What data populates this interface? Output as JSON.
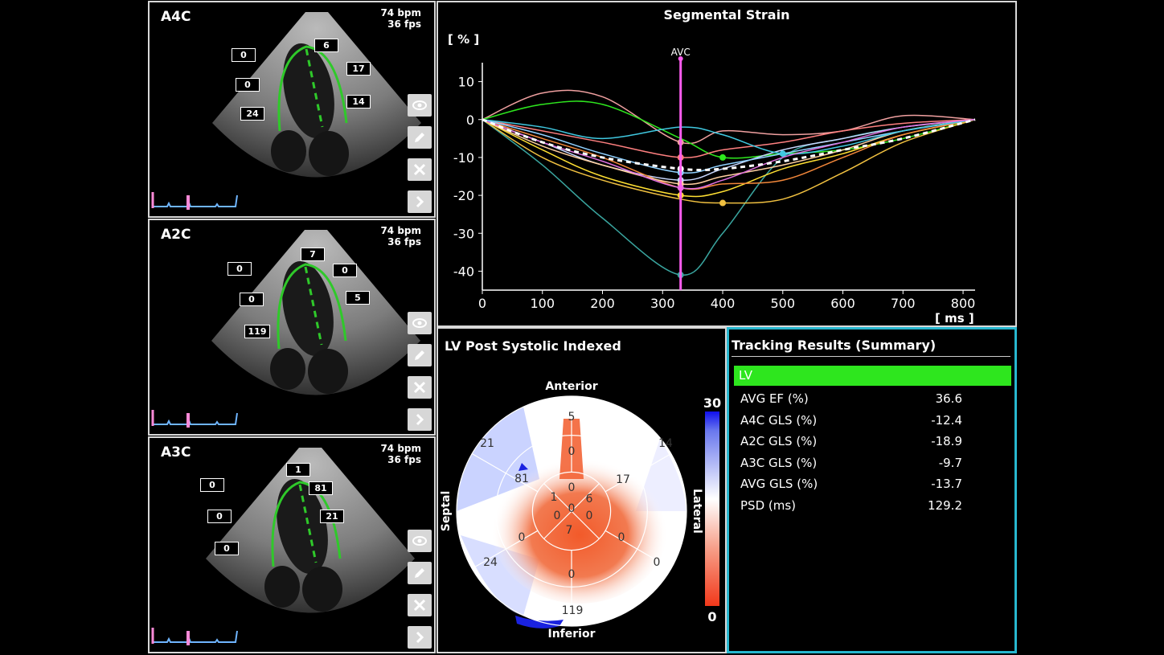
{
  "echo_views": [
    {
      "label": "A4C",
      "bpm": "74 bpm",
      "fps": "36 fps",
      "segments": [
        "0",
        "6",
        "0",
        "17",
        "24",
        "14"
      ]
    },
    {
      "label": "A2C",
      "bpm": "74 bpm",
      "fps": "36 fps",
      "segments": [
        "0",
        "7",
        "0",
        "0",
        "119",
        "5"
      ]
    },
    {
      "label": "A3C",
      "bpm": "74 bpm",
      "fps": "36 fps",
      "segments": [
        "1",
        "0",
        "81",
        "0",
        "21",
        "0"
      ]
    }
  ],
  "strain_chart": {
    "title": "Segmental Strain",
    "y_unit": "[ % ]",
    "x_unit": "[ ms ]",
    "marker_label": "AVC",
    "y_ticks": [
      "10",
      "0",
      "-10",
      "-20",
      "-30",
      "-40"
    ],
    "x_ticks": [
      "0",
      "100",
      "200",
      "300",
      "400",
      "500",
      "600",
      "700",
      "800"
    ]
  },
  "polar_map": {
    "title": "LV Post Systolic Indexed",
    "anterior": "Anterior",
    "inferior": "Inferior",
    "septal": "Septal",
    "lateral": "Lateral",
    "scale_max": "30",
    "scale_min": "0",
    "segment_values": [
      "5",
      "0",
      "14",
      "17",
      "0",
      "6",
      "21",
      "81",
      "1",
      "0",
      "0",
      "7",
      "0",
      "0",
      "0",
      "24",
      "0",
      "119",
      "0"
    ]
  },
  "results": {
    "title": "Tracking Results (Summary)",
    "group": "LV",
    "rows": [
      {
        "label": "AVG EF (%)",
        "value": "36.6"
      },
      {
        "label": "A4C GLS (%)",
        "value": "-12.4"
      },
      {
        "label": "A2C GLS (%)",
        "value": "-18.9"
      },
      {
        "label": "A3C GLS (%)",
        "value": "-9.7"
      },
      {
        "label": "AVG GLS (%)",
        "value": "-13.7"
      },
      {
        "label": "PSD (ms)",
        "value": "129.2"
      }
    ]
  },
  "colors": {
    "accent": "#27b7cf",
    "lv_bar": "#2ee61e",
    "avc_marker": "#ff5cf0",
    "contour": "#2fc92a"
  },
  "chart_data": {
    "type": "line",
    "title": "Segmental Strain",
    "xlabel": "[ ms ]",
    "ylabel": "[ % ]",
    "xlim": [
      0,
      820
    ],
    "ylim": [
      -45,
      15
    ],
    "x": [
      0,
      100,
      200,
      330,
      400,
      500,
      600,
      700,
      820
    ],
    "series": [
      {
        "color": "#3aa6a0",
        "values": [
          0,
          -12,
          -26,
          -41,
          -30,
          -10,
          -5,
          -2,
          0
        ]
      },
      {
        "color": "#f0a0a0",
        "values": [
          0,
          7,
          6,
          -6,
          -3,
          -4,
          -3,
          1,
          0
        ]
      },
      {
        "color": "#2ee61e",
        "values": [
          0,
          4,
          4,
          -5,
          -10,
          -9,
          -8,
          -5,
          0
        ]
      },
      {
        "color": "#f0c040",
        "values": [
          0,
          -10,
          -16,
          -21,
          -22,
          -21,
          -14,
          -6,
          0
        ]
      },
      {
        "color": "#ffe033",
        "values": [
          0,
          -8,
          -15,
          -20,
          -19,
          -13,
          -9,
          -4,
          0
        ]
      },
      {
        "color": "#c8d8ff",
        "values": [
          0,
          -6,
          -12,
          -16,
          -13,
          -8,
          -5,
          -2,
          0
        ]
      },
      {
        "color": "#f2873a",
        "values": [
          0,
          -5,
          -10,
          -18,
          -17,
          -16,
          -10,
          -4,
          0
        ]
      },
      {
        "color": "#ff8080",
        "values": [
          0,
          -3,
          -6,
          -10,
          -8,
          -6,
          -3,
          -1,
          0
        ]
      },
      {
        "color": "#8fd0ff",
        "values": [
          0,
          -4,
          -9,
          -14,
          -12,
          -9,
          -6,
          -3,
          0
        ]
      },
      {
        "color": "#ffd0a0",
        "values": [
          0,
          -7,
          -12,
          -17,
          -15,
          -12,
          -8,
          -3,
          0
        ]
      },
      {
        "color": "#40c8e0",
        "values": [
          0,
          -2,
          -5,
          -2,
          -4,
          -9,
          -7,
          -3,
          0
        ]
      },
      {
        "color": "#e070e0",
        "values": [
          0,
          -6,
          -11,
          -18,
          -16,
          -10,
          -6,
          -2,
          0
        ]
      },
      {
        "color": "#ffffff",
        "values": [
          0,
          -6,
          -10,
          -13,
          -13,
          -11,
          -8,
          -5,
          0
        ],
        "dashed": true
      }
    ],
    "avc_x": 330
  }
}
